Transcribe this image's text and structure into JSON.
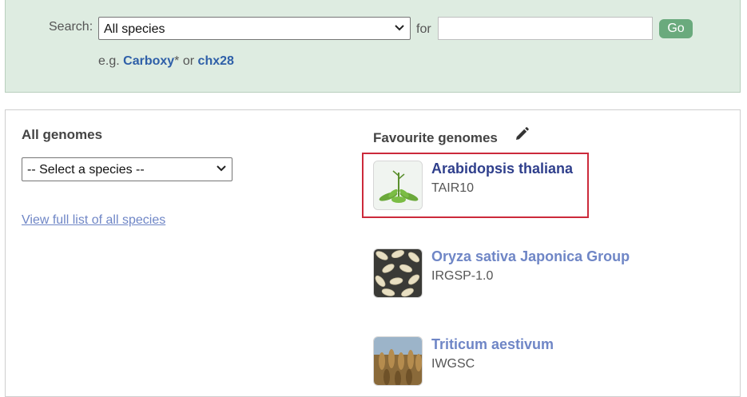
{
  "search": {
    "label": "Search:",
    "species_selected": "All species",
    "for_label": "for",
    "query_value": "",
    "go_label": "Go",
    "example_prefix": "e.g.",
    "example1": "Carboxy",
    "example1_suffix": "*",
    "example_or": "or",
    "example2": "chx28"
  },
  "all_genomes": {
    "title": "All genomes",
    "select_selected": "-- Select a species --",
    "view_link": "View full list of all species"
  },
  "favourites": {
    "title": "Favourite genomes",
    "items": [
      {
        "name": "Arabidopsis thaliana",
        "assembly": "TAIR10",
        "highlighted": true,
        "name_color": "#2f3f8c"
      },
      {
        "name": "Oryza sativa Japonica Group",
        "assembly": "IRGSP-1.0",
        "highlighted": false,
        "name_color": "#6f86c6"
      },
      {
        "name": "Triticum aestivum",
        "assembly": "IWGSC",
        "highlighted": false,
        "name_color": "#6f86c6"
      }
    ]
  },
  "colors": {
    "search_bg": "#deece1",
    "go_button": "#6aaa7d",
    "link": "#2e5fa8",
    "highlight_border": "#cc2a3b"
  },
  "icons": [
    "chevron-down-icon",
    "pencil-icon"
  ]
}
